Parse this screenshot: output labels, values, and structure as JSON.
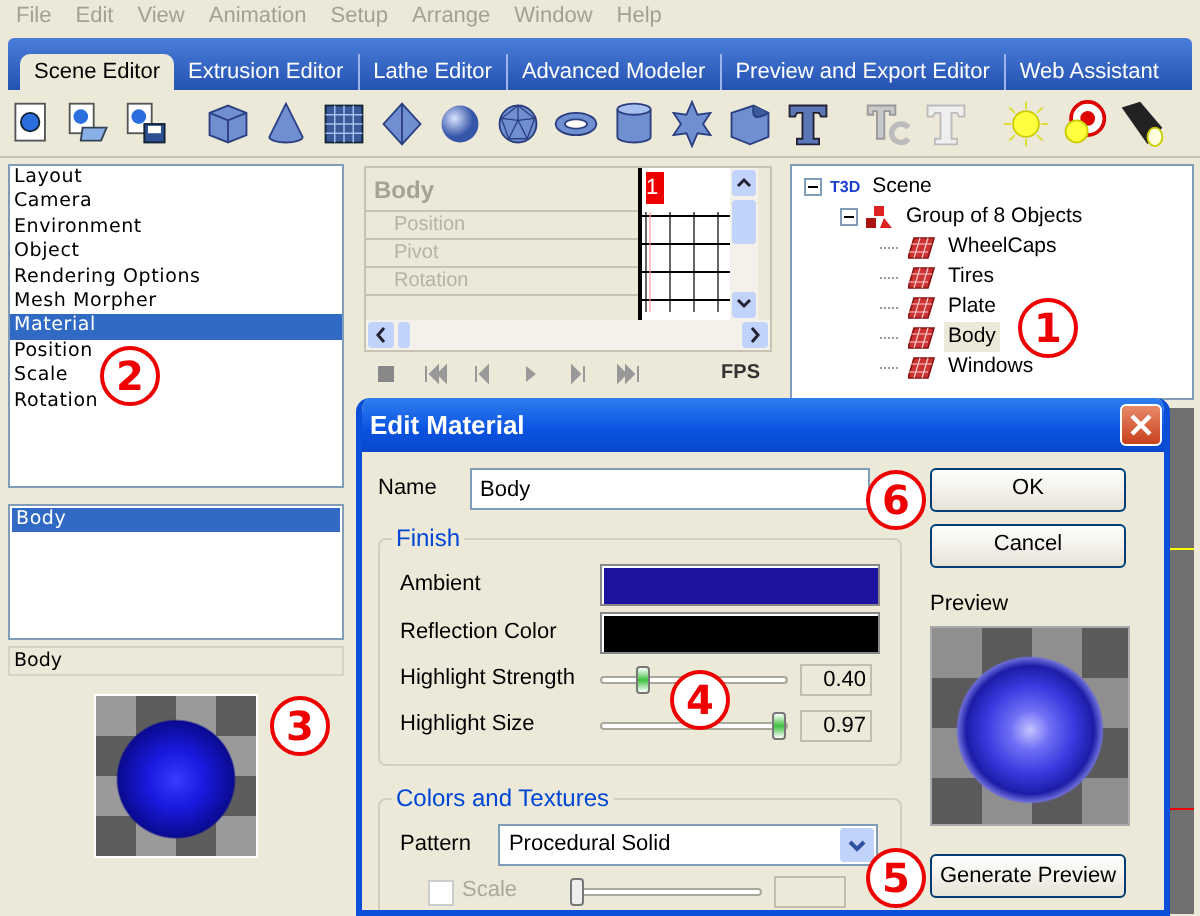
{
  "menu": [
    {
      "label": "File"
    },
    {
      "label": "Edit"
    },
    {
      "label": "View"
    },
    {
      "label": "Animation"
    },
    {
      "label": "Setup"
    },
    {
      "label": "Arrange"
    },
    {
      "label": "Window"
    },
    {
      "label": "Help"
    }
  ],
  "tabs": [
    {
      "label": "Scene Editor",
      "selected": true
    },
    {
      "label": "Extrusion Editor",
      "selected": false
    },
    {
      "label": "Lathe Editor",
      "selected": false
    },
    {
      "label": "Advanced Modeler",
      "selected": false
    },
    {
      "label": "Preview and Export Editor",
      "selected": false
    },
    {
      "label": "Web Assistant",
      "selected": false
    }
  ],
  "properties": [
    {
      "label": "Layout",
      "selected": false
    },
    {
      "label": "Camera",
      "selected": false
    },
    {
      "label": "Environment",
      "selected": false
    },
    {
      "label": "Object",
      "selected": false
    },
    {
      "label": "Rendering Options",
      "selected": false
    },
    {
      "label": "Mesh Morpher",
      "selected": false
    },
    {
      "label": "Material",
      "selected": true
    },
    {
      "label": "Position",
      "selected": false
    },
    {
      "label": "Scale",
      "selected": false
    },
    {
      "label": "Rotation",
      "selected": false
    }
  ],
  "materials": {
    "items": [
      {
        "label": "Body",
        "selected": true
      }
    ],
    "name": "Body"
  },
  "timeline": {
    "object": "Body",
    "tracks": [
      "Position",
      "Pivot",
      "Rotation"
    ],
    "frame": "1",
    "fps": "FPS"
  },
  "tree": {
    "label": "Scene",
    "logo": "T3D",
    "expanded": true,
    "children": [
      {
        "label": "Group of 8 Objects",
        "expanded": true,
        "children": [
          {
            "label": "WheelCaps",
            "selected": false
          },
          {
            "label": "Tires",
            "selected": false
          },
          {
            "label": "Plate",
            "selected": false
          },
          {
            "label": "Body",
            "selected": true
          },
          {
            "label": "Windows",
            "selected": false
          }
        ]
      }
    ]
  },
  "dialog": {
    "title": "Edit Material",
    "name_label": "Name",
    "name_value": "Body",
    "ok": "OK",
    "cancel": "Cancel",
    "finish": {
      "title": "Finish",
      "colors": [
        {
          "label": "Ambient",
          "color": "#1c14a0"
        },
        {
          "label": "Reflection Color",
          "color": "#000000"
        }
      ],
      "sliders": [
        {
          "label": "Highlight Strength",
          "level": 0.22,
          "reading": "0.40"
        },
        {
          "label": "Highlight Size",
          "level": 0.96,
          "reading": "0.97"
        }
      ]
    },
    "textures": {
      "title": "Colors and Textures",
      "pattern_label": "Pattern",
      "pattern_value": "Procedural Solid",
      "options": [
        {
          "label": "Scale",
          "checked": false,
          "disabled": true
        }
      ]
    },
    "preview_label": "Preview",
    "generate": "Generate Preview"
  },
  "callouts": [
    "1",
    "2",
    "3",
    "4",
    "5",
    "6"
  ]
}
